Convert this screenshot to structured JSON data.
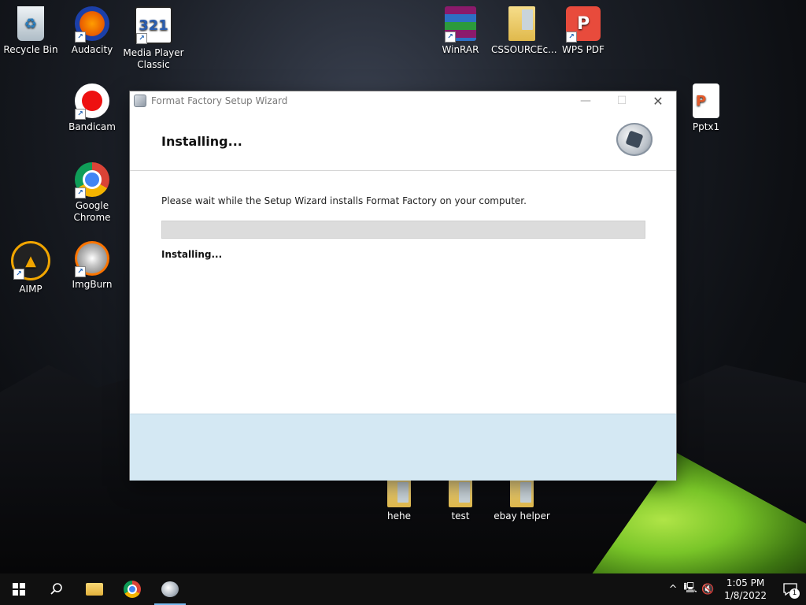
{
  "desktop": {
    "icons": [
      {
        "label": "Recycle Bin",
        "icon": "recycle-bin-icon"
      },
      {
        "label": "Audacity",
        "icon": "audacity-icon"
      },
      {
        "label": "Media Player Classic",
        "icon": "media-player-classic-icon",
        "icon_text": "321"
      },
      {
        "label": "Bandicam",
        "icon": "bandicam-icon"
      },
      {
        "label": "Google Chrome",
        "icon": "chrome-icon"
      },
      {
        "label": "AIMP",
        "icon": "aimp-icon"
      },
      {
        "label": "ImgBurn",
        "icon": "imgburn-icon"
      },
      {
        "label": "WinRAR",
        "icon": "winrar-icon"
      },
      {
        "label": "CSSOURCEc...",
        "icon": "folder-icon"
      },
      {
        "label": "WPS PDF",
        "icon": "wps-pdf-icon"
      },
      {
        "label": "Pptx1",
        "icon": "pptx-file-icon"
      },
      {
        "label": "hehe",
        "icon": "folder-icon"
      },
      {
        "label": "test",
        "icon": "folder-icon"
      },
      {
        "label": "ebay helper",
        "icon": "folder-icon"
      }
    ]
  },
  "window": {
    "title": "Format Factory Setup Wizard",
    "minimize_symbol": "—",
    "maximize_symbol": "☐",
    "close_symbol": "✕",
    "header_title": "Installing...",
    "body_text": "Please wait while the Setup Wizard installs Format Factory on your computer.",
    "status_text": "Installing...",
    "progress": 0
  },
  "taskbar": {
    "time": "1:05 PM",
    "date": "1/8/2022",
    "notification_count": "1"
  },
  "colors": {
    "footer": "#d4e8f3",
    "progress_track": "#dcdcdc",
    "taskbar": "#101010"
  }
}
